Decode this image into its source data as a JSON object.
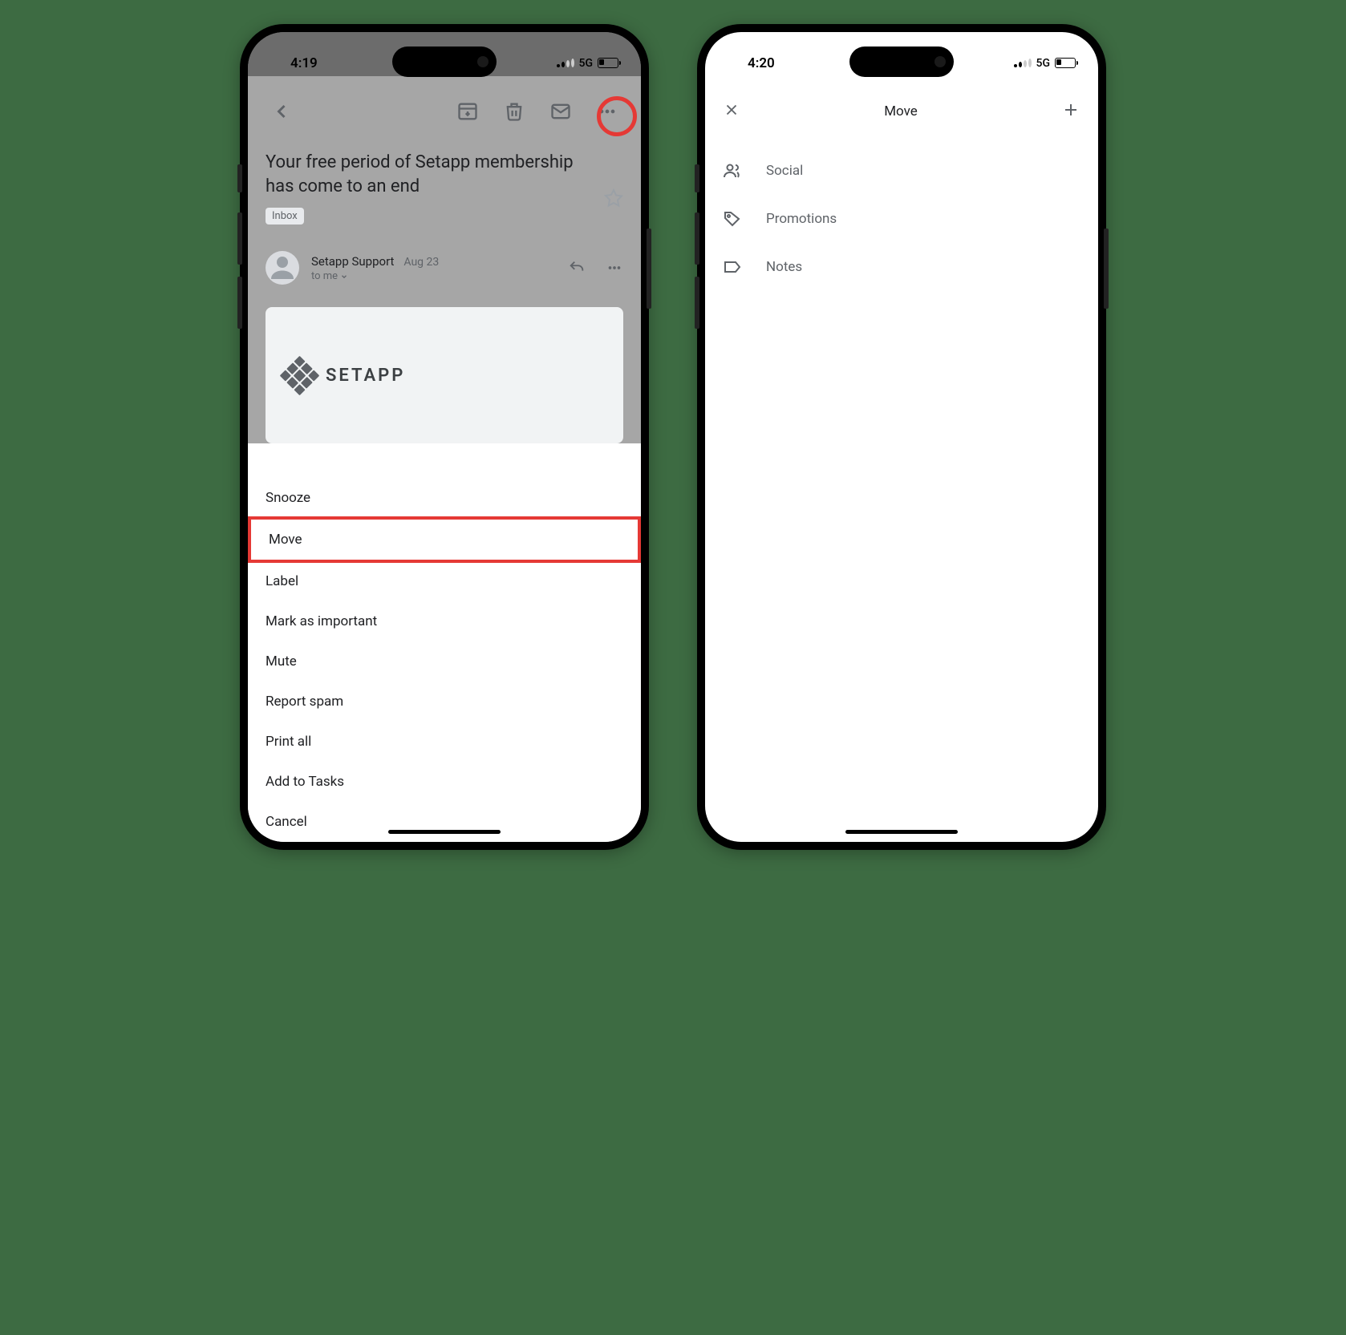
{
  "phone1": {
    "status": {
      "time": "4:19",
      "network": "5G"
    },
    "email": {
      "subject": "Your free period of Setapp membership has come to an end",
      "label": "Inbox",
      "sender": "Setapp Support",
      "date": "Aug 23",
      "to": "to me",
      "body_logo": "SETAPP"
    },
    "action_sheet": {
      "items": [
        "Snooze",
        "Move",
        "Label",
        "Mark as important",
        "Mute",
        "Report spam",
        "Print all",
        "Add to Tasks",
        "Cancel"
      ]
    }
  },
  "phone2": {
    "status": {
      "time": "4:20",
      "network": "5G"
    },
    "header": {
      "title": "Move"
    },
    "folders": [
      {
        "icon": "people",
        "label": "Social"
      },
      {
        "icon": "tag",
        "label": "Promotions"
      },
      {
        "icon": "label",
        "label": "Notes"
      }
    ]
  }
}
